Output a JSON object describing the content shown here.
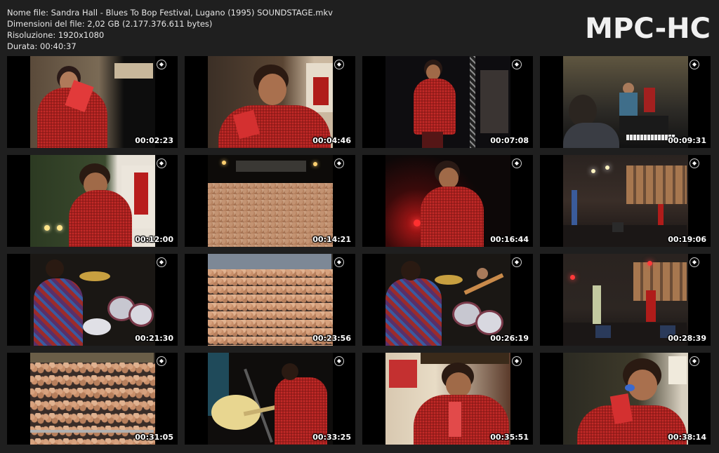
{
  "file_info": {
    "filename_line": "Nome file: Sandra Hall - Blues To Bop Festival, Lugano (1995) SOUNDSTAGE.mkv",
    "size_line": "Dimensioni del file: 2,02 GB (2.177.376.611 bytes)",
    "resolution_line": "Risoluzione: 1920x1080",
    "duration_line": "Durata: 00:40:37"
  },
  "logo_text": "MPC-HC",
  "thumbnails": [
    {
      "time": "00:02:23",
      "scene": "singer-red-scarf"
    },
    {
      "time": "00:04:46",
      "scene": "singer-mic-closeup"
    },
    {
      "time": "00:07:08",
      "scene": "singer-stage-dark"
    },
    {
      "time": "00:09:31",
      "scene": "band-keyboard"
    },
    {
      "time": "00:12:00",
      "scene": "singer-banner"
    },
    {
      "time": "00:14:21",
      "scene": "crowd-night"
    },
    {
      "time": "00:16:44",
      "scene": "singer-red-light"
    },
    {
      "time": "00:19:06",
      "scene": "stage-wide"
    },
    {
      "time": "00:21:30",
      "scene": "drummer"
    },
    {
      "time": "00:23:56",
      "scene": "crowd-day"
    },
    {
      "time": "00:26:19",
      "scene": "drummer-guitar"
    },
    {
      "time": "00:28:39",
      "scene": "stage-wide-red"
    },
    {
      "time": "00:31:05",
      "scene": "crowd-front"
    },
    {
      "time": "00:33:25",
      "scene": "guitarist"
    },
    {
      "time": "00:35:51",
      "scene": "singer-banner-2"
    },
    {
      "time": "00:38:14",
      "scene": "singer-closeup-2"
    }
  ],
  "colors": {
    "background": "#1f1f1f",
    "text": "#e6e6e6",
    "sequin_red": "#a3201f"
  }
}
